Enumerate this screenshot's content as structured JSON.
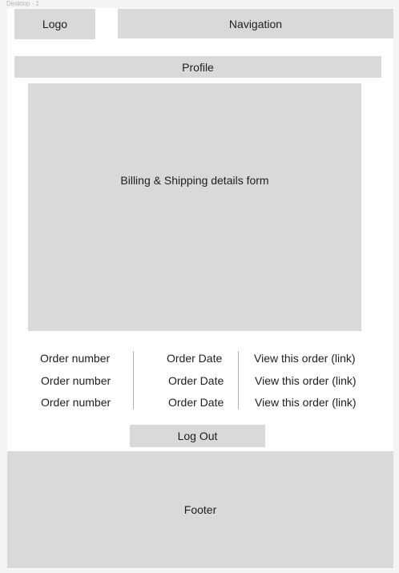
{
  "frame": {
    "label": "Desktop - 1"
  },
  "header": {
    "logo": "Logo",
    "navigation": "Navigation"
  },
  "profile": {
    "label": "Profile"
  },
  "form": {
    "label": "Billing & Shipping details form"
  },
  "orders": {
    "rows": [
      {
        "number": "Order number",
        "date": "Order Date",
        "link": "View this order (link)"
      },
      {
        "number": "Order number",
        "date": "Order Date",
        "link": "View this order (link)"
      },
      {
        "number": "Order number",
        "date": "Order Date",
        "link": "View this order (link)"
      }
    ]
  },
  "logout": {
    "label": "Log Out"
  },
  "footer": {
    "label": "Footer"
  },
  "colors": {
    "placeholder": "#d9d9d9",
    "frame": "#ffffff",
    "canvas": "#f4f4f4",
    "divider": "#b3b3b3"
  }
}
